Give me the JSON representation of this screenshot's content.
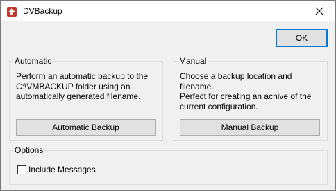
{
  "window": {
    "title": "DVBackup",
    "icon": "upload-icon",
    "close_icon": "close-icon"
  },
  "toolbar": {
    "ok_label": "OK"
  },
  "automatic": {
    "legend": "Automatic",
    "description": "Perform an automatic backup to the\nC:\\VMBACKUP folder using an\nautomatically generated filename.",
    "button_label": "Automatic Backup"
  },
  "manual": {
    "legend": "Manual",
    "description": "Choose a backup location and filename.\nPerfect for creating an achive of the\ncurrent configuration.",
    "button_label": "Manual Backup"
  },
  "options": {
    "legend": "Options",
    "include_messages_label": "Include Messages",
    "include_messages_checked": false
  },
  "colors": {
    "accent": "#0078d7",
    "icon_red": "#c0392b"
  }
}
